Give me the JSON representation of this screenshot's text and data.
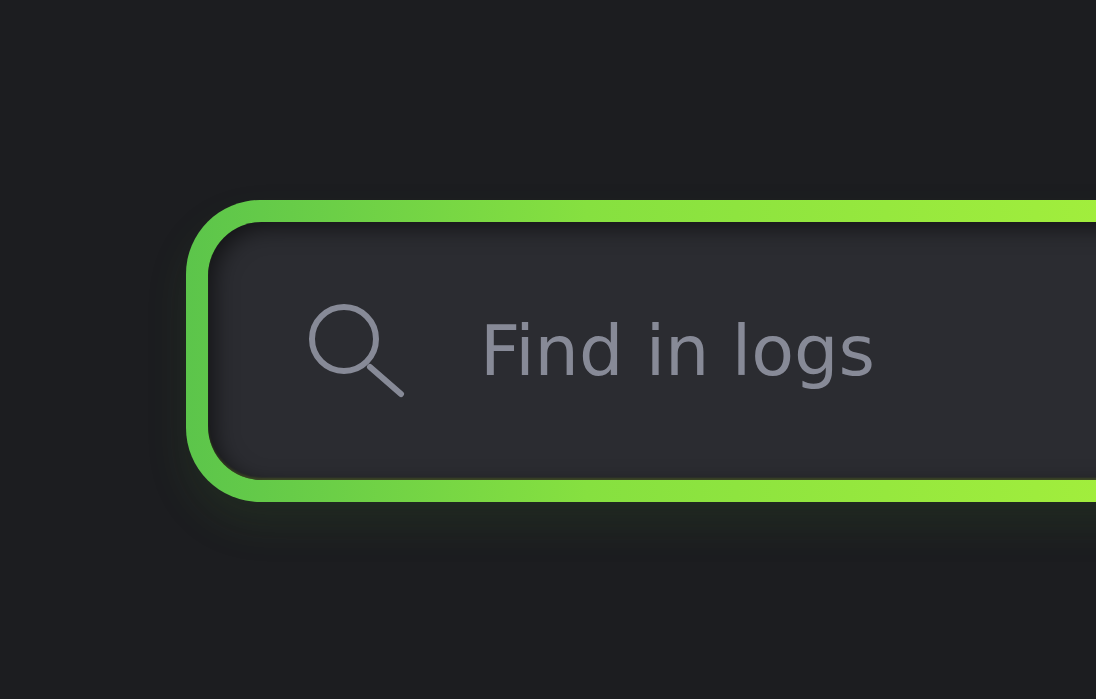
{
  "search": {
    "placeholder": "Find in logs"
  }
}
